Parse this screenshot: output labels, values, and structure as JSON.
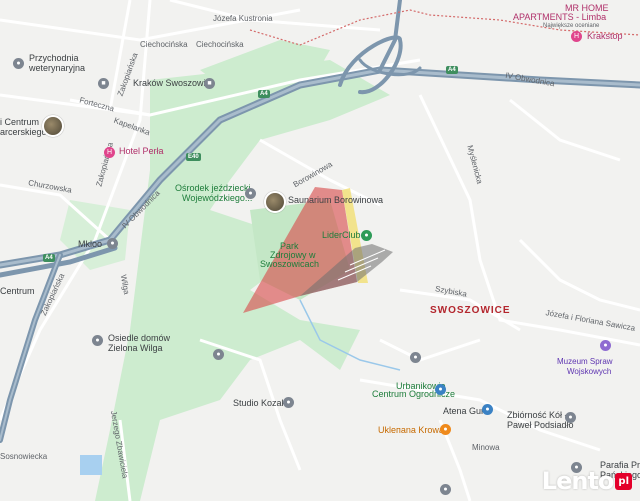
{
  "map": {
    "district_label": "SWOSZOWICE",
    "shields": {
      "a4_top": "A4",
      "a4_left": "A4",
      "a4_mid": "A4",
      "e40": "E40",
      "e40_left": "E40"
    },
    "streets": {
      "jozefa_kustronia": "Józefa Kustronia",
      "ciechocinska_1": "Ciechocińska",
      "ciechocinska_2": "Ciechocińska",
      "krakow_swoszowice": "Kraków Swoszowice",
      "zakopianska_top": "Zakopiańska",
      "forteczna": "Forteczna",
      "kapelanka": "Kapelanka",
      "zakopianska_mid": "Zakopiańska",
      "churzowska": "Churzowska",
      "iv_obwodnica_left": "IV Obwodnica",
      "iv_obwodnica_right": "IV Obwodnica",
      "borowinowa_curve": "Borowinowa",
      "myslenicka": "Myślenicka",
      "szybiska": "Szybiska",
      "jozefa_i_floriana": "Józefa i Floriana Sawicza",
      "wilga": "Wilga",
      "zakopianska_bottom": "Zakopiańska",
      "jerzego_zbawiciela": "Jerzego Zbawiciela",
      "minowa": "Minowa",
      "sosnowiecka": "Sosnowiecka"
    },
    "pois": {
      "przychodnia_1": "Przychodnia",
      "przychodnia_2": "weterynaryjna",
      "hotel_perla": "Hotel Perła",
      "centrum_1": "i Centrum",
      "centrum_2": "arcerskiego",
      "osrodek_1": "Ośrodek jeździecki",
      "osrodek_2": "Wojewódzkiego...",
      "saunarium": "Saunarium Borowinowa",
      "liderclub": "LiderClub",
      "park_1": "Park",
      "park_2": "Zdrojowy w",
      "park_3": "Swoszowicach",
      "mk_loo": "Mkloo",
      "centrum_short": "Centrum",
      "osiedle_1": "Osiedle domów",
      "osiedle_2": "Zielona Wilga",
      "studio_kozak": "Studio Kozak",
      "urbanikowie_1": "Urbanikowie",
      "urbanikowie_2": "Centrum Ogrodnicze",
      "atena_gun": "Atena Gun",
      "uklepana_krowa": "Ukleпana Krowa",
      "zbiornosc_1": "Zbiórność Kół -",
      "zbiornosc_2": "Paweł Podsiadło",
      "muzeum_1": "Muzeum Spraw",
      "muzeum_2": "Wojskowych",
      "mr_home_1": "MR HOME",
      "mr_home_2": "APARTMENTS - Limba",
      "mr_home_3": "Największe oceniane",
      "krakstop": "Krakstop",
      "parafia_1": "Parafia Przem",
      "parafia_2": "Pańskiego"
    },
    "colors": {
      "background": "#f2f2f0",
      "green_area": "#cdeccf",
      "motorway": "#7d96ad",
      "road": "#ffffff",
      "overlay_red": "#d94c4c",
      "overlay_yellow": "#f2e07a",
      "overlay_gray": "#6f6f6f"
    }
  },
  "watermark": {
    "text": "Lento",
    "badge": "pl"
  }
}
